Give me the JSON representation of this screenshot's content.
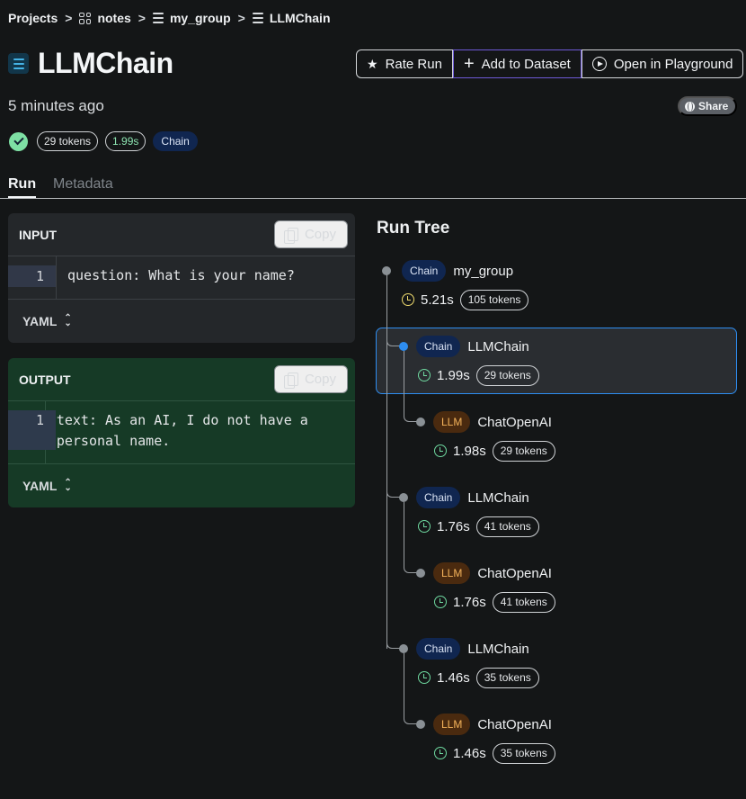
{
  "breadcrumb": {
    "items": [
      {
        "label": "Projects",
        "icon": ""
      },
      {
        "label": "notes",
        "icon": "grid-icon"
      },
      {
        "label": "my_group",
        "icon": "stack-icon"
      },
      {
        "label": "LLMChain",
        "icon": "stack-icon"
      }
    ],
    "separator": ">"
  },
  "header": {
    "title": "LLMChain",
    "time_ago": "5 minutes ago",
    "share_label": "Share",
    "actions": {
      "rate_label": "Rate Run",
      "add_dataset_label": "Add to Dataset",
      "playground_label": "Open in Playground"
    }
  },
  "stats": {
    "tokens": "29 tokens",
    "latency": "1.99s",
    "type": "Chain",
    "status_color": "#7ee0a4"
  },
  "tabs": {
    "run": "Run",
    "metadata": "Metadata"
  },
  "input_panel": {
    "label": "INPUT",
    "copy_label": "Copy",
    "line_number": "1",
    "code": "question: What is your name?",
    "format": "YAML"
  },
  "output_panel": {
    "label": "OUTPUT",
    "copy_label": "Copy",
    "line_number": "1",
    "code": "text: As an AI, I do not have a personal name.",
    "format": "YAML"
  },
  "run_tree": {
    "title": "Run Tree",
    "nodes": [
      {
        "type": "Chain",
        "name": "my_group",
        "duration": "5.21s",
        "tokens": "105 tokens",
        "clock_color": "#f0dc6e"
      },
      {
        "type": "Chain",
        "name": "LLMChain",
        "duration": "1.99s",
        "tokens": "29 tokens",
        "selected": true
      },
      {
        "type": "LLM",
        "name": "ChatOpenAI",
        "duration": "1.98s",
        "tokens": "29 tokens"
      },
      {
        "type": "Chain",
        "name": "LLMChain",
        "duration": "1.76s",
        "tokens": "41 tokens"
      },
      {
        "type": "LLM",
        "name": "ChatOpenAI",
        "duration": "1.76s",
        "tokens": "41 tokens"
      },
      {
        "type": "Chain",
        "name": "LLMChain",
        "duration": "1.46s",
        "tokens": "35 tokens"
      },
      {
        "type": "LLM",
        "name": "ChatOpenAI",
        "duration": "1.46s",
        "tokens": "35 tokens"
      }
    ]
  },
  "colors": {
    "background": "#141617",
    "chain_badge": "#102650",
    "llm_badge": "#4a2a0f",
    "selected": "#2e8df0",
    "output_bg": "#163a26"
  }
}
